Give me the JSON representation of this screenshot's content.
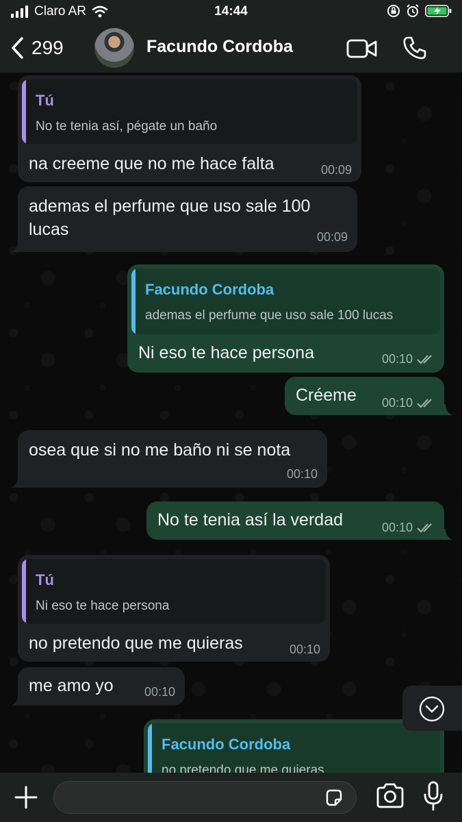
{
  "status_bar": {
    "carrier": "Claro AR",
    "time": "14:44"
  },
  "header": {
    "back_count": "299",
    "contact_name": "Facundo Cordoba"
  },
  "messages": [
    {
      "dir": "in",
      "quote_name": "Tú",
      "quote_text": "No te tenia así, pégate un baño",
      "text": "na creeme que no me hace falta",
      "time": "00:09"
    },
    {
      "dir": "in",
      "text_line1": "ademas el perfume que uso sale 100",
      "text_line2": "lucas",
      "time": "00:09"
    },
    {
      "dir": "out",
      "quote_name": "Facundo Cordoba",
      "quote_text": "ademas el perfume que uso sale 100 lucas",
      "text": "Ni eso te hace persona",
      "time": "00:10"
    },
    {
      "dir": "out",
      "text": "Créeme",
      "time": "00:10"
    },
    {
      "dir": "in",
      "text": "osea que si no me baño ni se nota",
      "time": "00:10"
    },
    {
      "dir": "out",
      "text": "No te tenia así la verdad",
      "time": "00:10"
    },
    {
      "dir": "in",
      "quote_name": "Tú",
      "quote_text": "Ni eso te hace persona",
      "text": "no pretendo que me quieras",
      "time": "00:10"
    },
    {
      "dir": "in",
      "text": "me amo yo",
      "time": "00:10"
    },
    {
      "dir": "out",
      "quote_name": "Facundo Cordoba",
      "quote_text": "no pretendo que me quieras"
    }
  ],
  "icons": {
    "back": "chevron-left-icon",
    "video": "video-camera-icon",
    "call": "phone-icon",
    "scroll": "chevron-down-icon",
    "plus": "plus-icon",
    "sticker": "sticker-icon",
    "camera": "camera-icon",
    "mic": "microphone-icon"
  },
  "colors": {
    "incoming_bubble": "#1f2124",
    "outgoing_bubble": "#1e4433",
    "quote_me": "#a88fe8",
    "quote_other": "#53bdeb"
  }
}
